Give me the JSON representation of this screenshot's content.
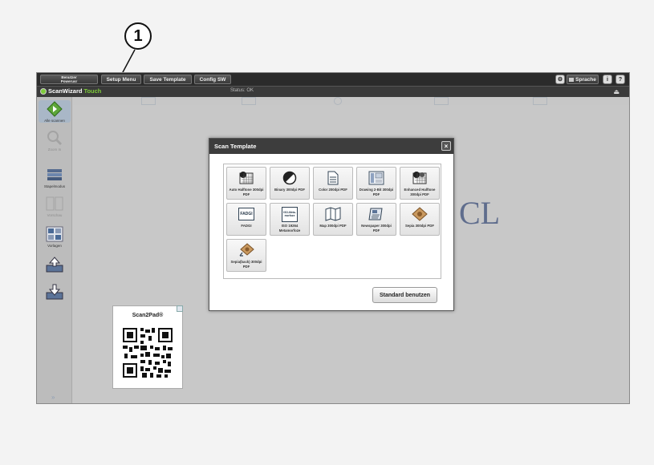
{
  "callout": {
    "number": "1"
  },
  "topbar": {
    "user_line1": "Benutzer",
    "user_line2": "Powerusr",
    "setup_menu": "Setup Menu",
    "save_template": "Save Template",
    "config_sw": "Config SW",
    "sprache": "Sprache",
    "info": "i",
    "help": "?"
  },
  "titlebar": {
    "brand_main": "ScanWizard",
    "brand_accent": "Touch",
    "status": "Status: OK"
  },
  "sidebar": {
    "items": [
      {
        "label": "Alle scannen",
        "icon": "start-scan-icon"
      },
      {
        "label": "Zoom In",
        "icon": "zoom-icon"
      },
      {
        "label": "Stapelmodus",
        "icon": "stack-icon"
      },
      {
        "label": "Vorschau",
        "icon": "split-view-icon"
      },
      {
        "label": "Vorlagen",
        "icon": "templates-icon"
      },
      {
        "label": "",
        "icon": "upload-icon"
      },
      {
        "label": "",
        "icon": "download-icon"
      }
    ]
  },
  "background_text": "CL",
  "modal": {
    "title": "Scan Template",
    "close": "×",
    "templates": [
      {
        "label": "Auto Halftone 300dpi PDF",
        "icon": "halftone-icon"
      },
      {
        "label": "Binary 300dpi PDF",
        "icon": "binary-icon"
      },
      {
        "label": "Color 200dpi PDF",
        "icon": "document-icon"
      },
      {
        "label": "Drawing 2-Bit 300dpi PDF",
        "icon": "drawing-icon"
      },
      {
        "label": "Enhanced Halftone 300dpi PDF",
        "icon": "enhanced-halftone-icon"
      },
      {
        "label": "FADGI",
        "icon": "fadgi-icon",
        "badge": "FADGI"
      },
      {
        "label": "ISO 19264 Metamorfoze",
        "icon": "iso-icon",
        "badge": "ISO-Meta-morfoze"
      },
      {
        "label": "Map 300dpi PDF",
        "icon": "map-icon"
      },
      {
        "label": "Newspaper 300dpi PDF",
        "icon": "newspaper-icon"
      },
      {
        "label": "Sepia 300dpi PDF",
        "icon": "sepia-icon"
      },
      {
        "label": "Sepia(back) 300dpi PDF",
        "icon": "sepia-back-icon"
      }
    ],
    "standard_button": "Standard benutzen"
  },
  "scan2pad": {
    "title": "Scan2Pad®"
  }
}
